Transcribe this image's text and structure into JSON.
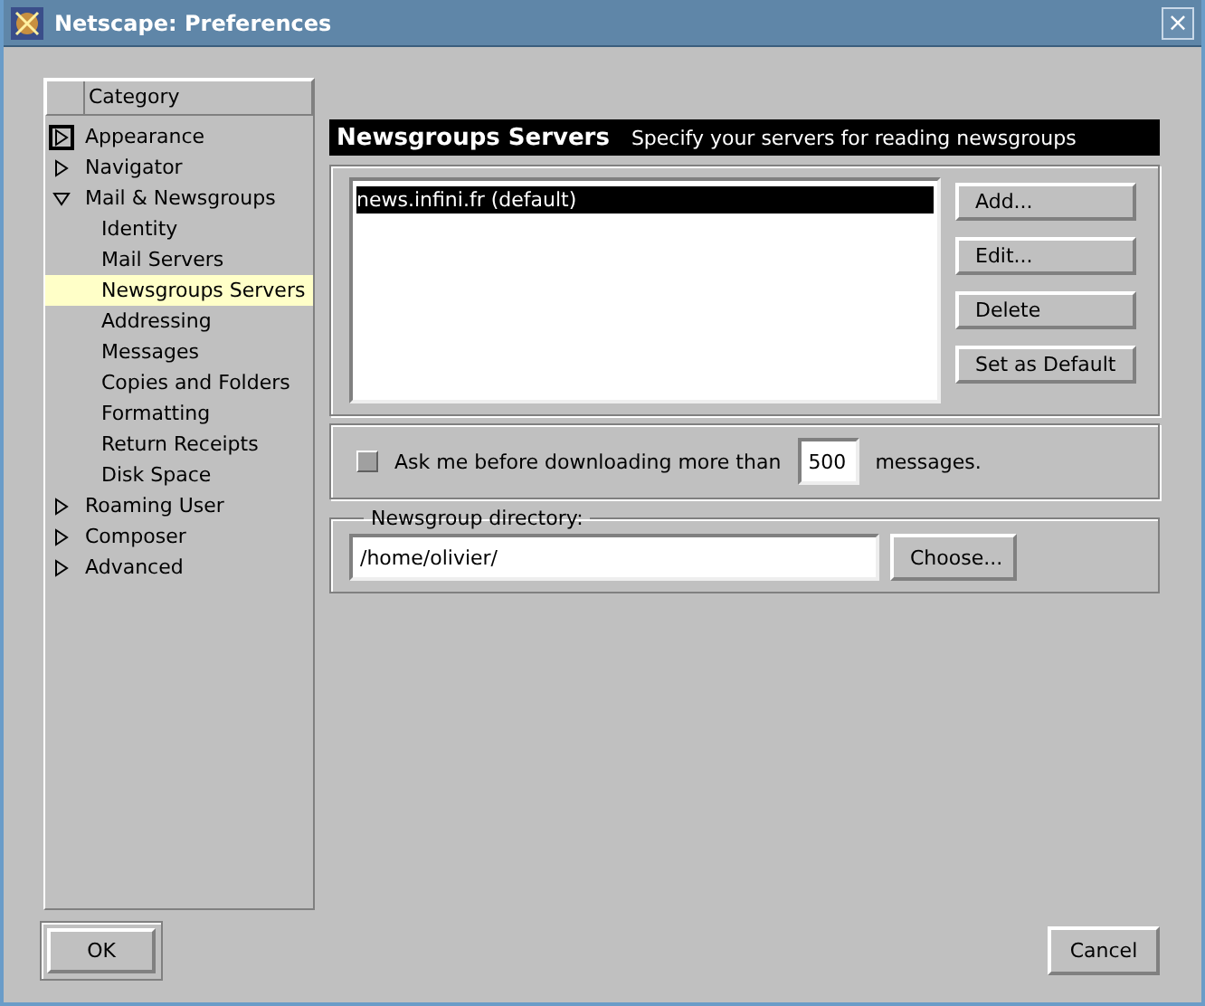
{
  "window": {
    "title": "Netscape: Preferences",
    "close": "×"
  },
  "sidebar": {
    "header": "Category",
    "items": [
      {
        "label": "Appearance",
        "expanded": false,
        "selected": false,
        "focused": true
      },
      {
        "label": "Navigator",
        "expanded": false,
        "selected": false,
        "focused": false
      },
      {
        "label": "Mail & Newsgroups",
        "expanded": true,
        "selected": false,
        "focused": false,
        "children": [
          {
            "label": "Identity",
            "selected": false
          },
          {
            "label": "Mail Servers",
            "selected": false
          },
          {
            "label": "Newsgroups Servers",
            "selected": true
          },
          {
            "label": "Addressing",
            "selected": false
          },
          {
            "label": "Messages",
            "selected": false
          },
          {
            "label": "Copies and Folders",
            "selected": false
          },
          {
            "label": "Formatting",
            "selected": false
          },
          {
            "label": "Return Receipts",
            "selected": false
          },
          {
            "label": "Disk Space",
            "selected": false
          }
        ]
      },
      {
        "label": "Roaming User",
        "expanded": false,
        "selected": false,
        "focused": false
      },
      {
        "label": "Composer",
        "expanded": false,
        "selected": false,
        "focused": false
      },
      {
        "label": "Advanced",
        "expanded": false,
        "selected": false,
        "focused": false
      }
    ]
  },
  "panel": {
    "title": "Newsgroups Servers",
    "subtitle": "Specify your servers for reading newsgroups",
    "servers": [
      {
        "label": "news.infini.fr (default)",
        "selected": true
      }
    ],
    "server_buttons": [
      "Add...",
      "Edit...",
      "Delete",
      "Set as Default"
    ],
    "ask": {
      "label": "Ask me before downloading more than",
      "checked": false,
      "value": "500",
      "suffix": "messages."
    },
    "directory": {
      "legend": "Newsgroup directory:",
      "value": "/home/olivier/",
      "button": "Choose..."
    }
  },
  "buttons": {
    "ok": "OK",
    "cancel": "Cancel"
  }
}
